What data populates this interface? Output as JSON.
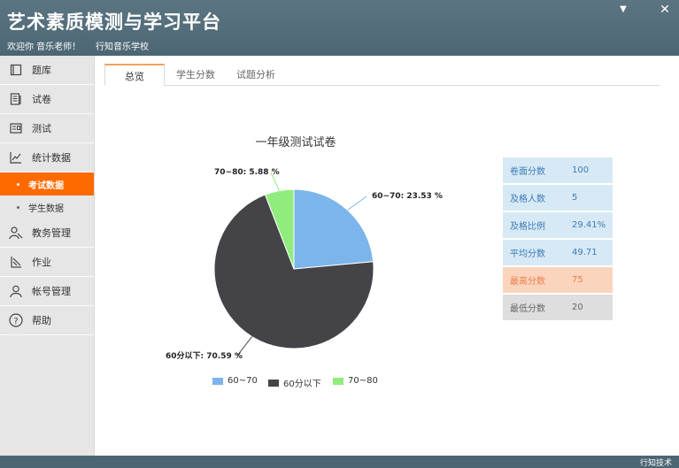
{
  "window": {
    "title": "艺术素质模测与学习平台",
    "welcome": "欢迎你 音乐老师！",
    "school": "行知音乐学校",
    "min_icon": "▼",
    "close_icon": "✕"
  },
  "sidebar": {
    "items": [
      {
        "label": "题库",
        "icon": "book-icon"
      },
      {
        "label": "试卷",
        "icon": "paper-icon"
      },
      {
        "label": "测试",
        "icon": "test-icon"
      },
      {
        "label": "统计数据",
        "icon": "chart-icon"
      },
      {
        "label": "教务管理",
        "icon": "users-icon"
      },
      {
        "label": "作业",
        "icon": "homework-icon"
      },
      {
        "label": "帐号管理",
        "icon": "user-icon"
      },
      {
        "label": "帮助",
        "icon": "help-icon"
      }
    ],
    "sub_items": [
      {
        "label": "考试数据"
      },
      {
        "label": "学生数据"
      }
    ]
  },
  "tabs": [
    {
      "label": "总览"
    },
    {
      "label": "学生分数"
    },
    {
      "label": "试题分析"
    }
  ],
  "chart_data": {
    "type": "pie",
    "title": "一年级测试试卷",
    "slices": [
      {
        "name": "60~70",
        "value": 23.53,
        "label": "60~70: 23.53 %",
        "color": "#7cb4ec"
      },
      {
        "name": "60分以下",
        "value": 70.59,
        "label": "60分以下: 70.59 %",
        "color": "#434348"
      },
      {
        "name": "70~80",
        "value": 5.88,
        "label": "70~80: 5.88 %",
        "color": "#90ed7d"
      }
    ],
    "legend_position": "bottom"
  },
  "stats": [
    {
      "label": "卷面分数",
      "value": "100",
      "bg": "#d6e9f5",
      "color": "#3d7cb6"
    },
    {
      "label": "及格人数",
      "value": "5",
      "bg": "#d6e9f5",
      "color": "#3d7cb6"
    },
    {
      "label": "及格比例",
      "value": "29.41%",
      "bg": "#d6e9f5",
      "color": "#3d7cb6"
    },
    {
      "label": "平均分数",
      "value": "49.71",
      "bg": "#d6e9f5",
      "color": "#3d7cb6"
    },
    {
      "label": "最高分数",
      "value": "75",
      "bg": "#fbd4bd",
      "color": "#e8804a"
    },
    {
      "label": "最低分数",
      "value": "20",
      "bg": "#dedede",
      "color": "#666666"
    }
  ],
  "footer": {
    "brand": "行知技术"
  }
}
